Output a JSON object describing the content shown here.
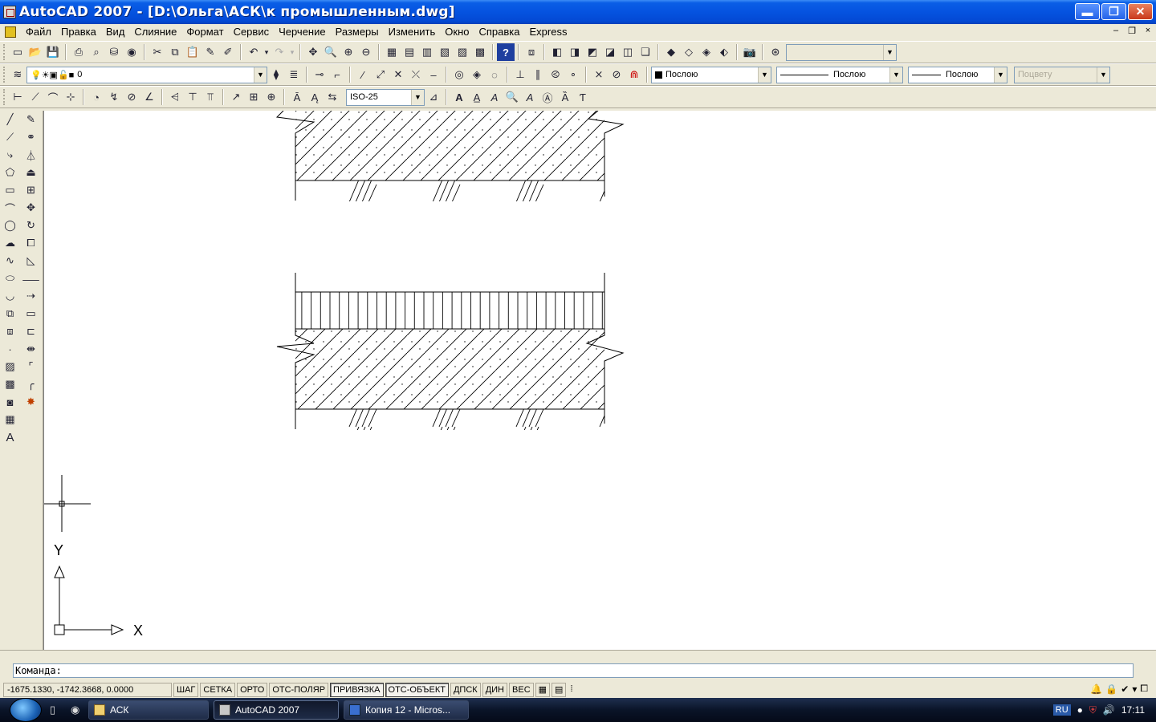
{
  "window": {
    "title": "AutoCAD 2007 - [D:\\Ольга\\АСК\\к промышленным.dwg]",
    "controls": {
      "minimize": "▬",
      "restore": "❐",
      "close": "✕"
    }
  },
  "menu": {
    "items": [
      "Файл",
      "Правка",
      "Вид",
      "Слияние",
      "Формат",
      "Сервис",
      "Черчение",
      "Размеры",
      "Изменить",
      "Окно",
      "Справка",
      "Express"
    ],
    "mdi_controls": [
      "–",
      "❐",
      "×"
    ]
  },
  "toolbar_properties": {
    "layer_value": "0",
    "color_value": "Послою",
    "linetype_value": "Послою",
    "lineweight_value": "Послою",
    "plotstyle_value": "Поцвету"
  },
  "toolbar_dimension": {
    "dimstyle_value": "ISO-25"
  },
  "drawing": {
    "ucs_x_label": "X",
    "ucs_y_label": "Y"
  },
  "command": {
    "prompt": "Команда:"
  },
  "status": {
    "coords": "-1675.1330, -1742.3668, 0.0000",
    "buttons": [
      {
        "label": "ШАГ",
        "on": false
      },
      {
        "label": "СЕТКА",
        "on": false
      },
      {
        "label": "ОРТО",
        "on": false
      },
      {
        "label": "ОТС-ПОЛЯР",
        "on": false
      },
      {
        "label": "ПРИВЯЗКА",
        "on": true
      },
      {
        "label": "ОТС-ОБЪЕКТ",
        "on": true
      },
      {
        "label": "ДПСК",
        "on": false
      },
      {
        "label": "ДИН",
        "on": false
      },
      {
        "label": "ВЕС",
        "on": false
      }
    ]
  },
  "taskbar": {
    "tasks": [
      {
        "label": "АСК",
        "active": false
      },
      {
        "label": "AutoCAD 2007",
        "active": true
      },
      {
        "label": "Копия 12 - Micros...",
        "active": false
      }
    ],
    "lang": "RU",
    "time": "17:11"
  }
}
